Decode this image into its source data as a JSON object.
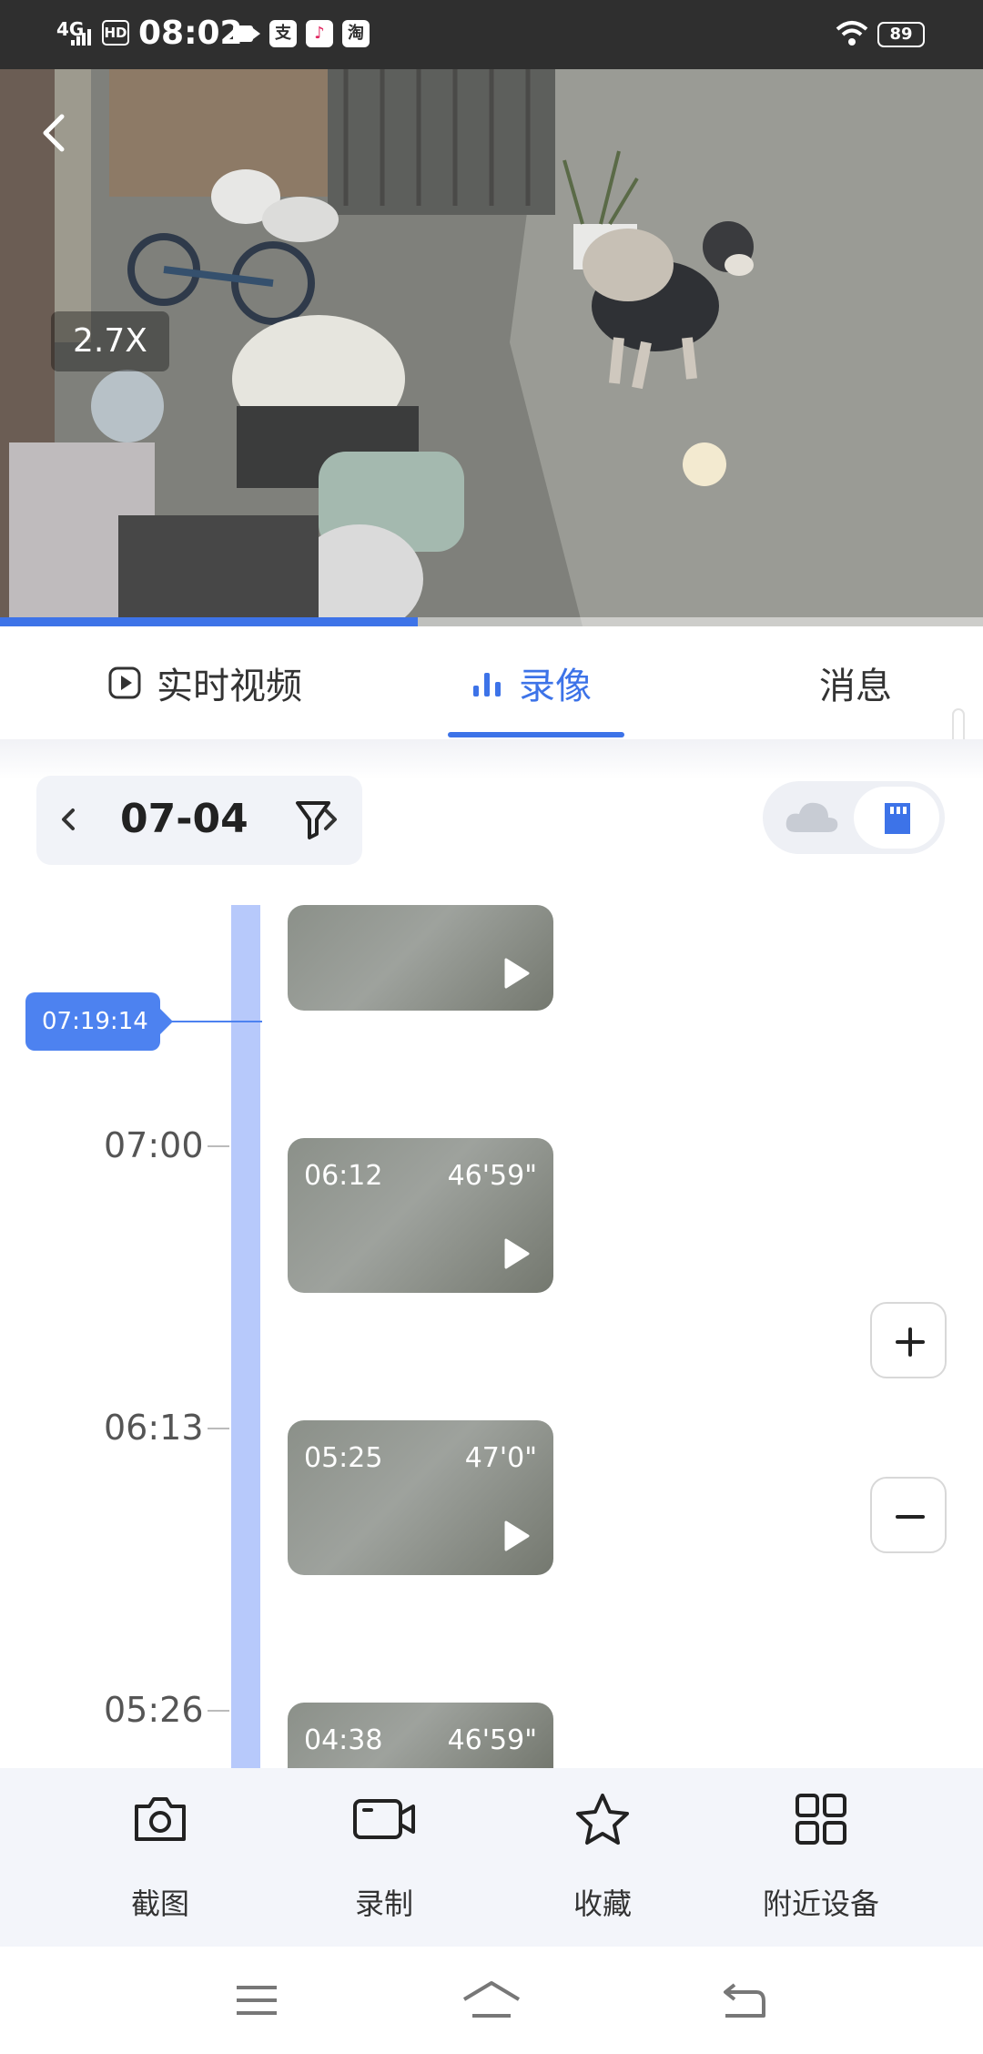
{
  "status_bar": {
    "network": "4G",
    "hd": "HD",
    "time": "08:02",
    "app_icons": [
      "支",
      "♪",
      "淘"
    ],
    "battery": "89"
  },
  "video": {
    "zoom_level": "2.7X",
    "playback_progress": 0.425
  },
  "tabs": [
    {
      "label": "实时视频",
      "icon": "play-icon",
      "active": false
    },
    {
      "label": "录像",
      "icon": "bar-chart-icon",
      "active": true
    },
    {
      "label": "消息",
      "icon": null,
      "active": false
    }
  ],
  "date_picker": {
    "date": "07-04"
  },
  "storage": {
    "options": [
      "cloud-icon",
      "sd-card-icon"
    ],
    "selected": "sd-card-icon",
    "accent": "#3d73e8"
  },
  "timeline": {
    "current_time": "07:19:14",
    "labels": [
      "07:00",
      "06:13",
      "05:26"
    ],
    "clips": [
      {
        "start": "",
        "duration": ""
      },
      {
        "start": "06:12",
        "duration": "46'59\""
      },
      {
        "start": "05:25",
        "duration": "47'0\""
      },
      {
        "start": "04:38",
        "duration": "46'59\""
      }
    ]
  },
  "zoom_controls": [
    "+",
    "−"
  ],
  "actions": [
    {
      "label": "截图",
      "icon": "camera-icon"
    },
    {
      "label": "录制",
      "icon": "video-record-icon"
    },
    {
      "label": "收藏",
      "icon": "star-icon"
    },
    {
      "label": "附近设备",
      "icon": "grid-icon"
    }
  ],
  "navbar": [
    "menu-icon",
    "home-icon",
    "back-icon"
  ]
}
